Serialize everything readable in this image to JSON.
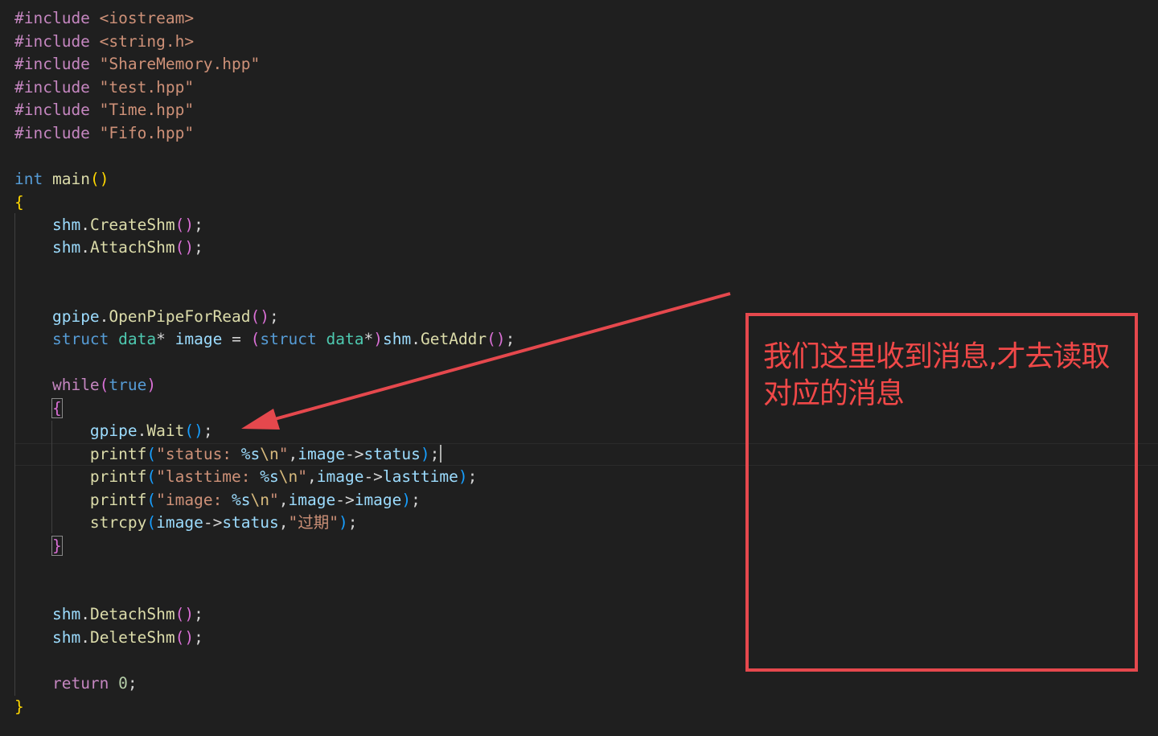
{
  "editor": {
    "lines": {
      "l1": {
        "kw": "#include",
        "arg": "<iostream>"
      },
      "l2": {
        "kw": "#include",
        "arg": "<string.h>"
      },
      "l3": {
        "kw": "#include",
        "arg": "\"ShareMemory.hpp\""
      },
      "l4": {
        "kw": "#include",
        "arg": "\"test.hpp\""
      },
      "l5": {
        "kw": "#include",
        "arg": "\"Time.hpp\""
      },
      "l6": {
        "kw": "#include",
        "arg": "\"Fifo.hpp\""
      },
      "l8": {
        "type": "int",
        "fn": "main",
        "parens": "()"
      },
      "l9": {
        "brace": "{"
      },
      "l10": {
        "obj": "shm",
        "fn": "CreateShm"
      },
      "l11": {
        "obj": "shm",
        "fn": "AttachShm"
      },
      "l14": {
        "obj": "gpipe",
        "fn": "OpenPipeForRead"
      },
      "l15": {
        "struct": "struct",
        "type": "data",
        "star": "*",
        "var": "image",
        "eq": " = ",
        "cast_struct": "struct",
        "cast_type": "data",
        "cast_star": "*",
        "obj": "shm",
        "fn": "GetAddr"
      },
      "l17": {
        "kw": "while",
        "cond": "true"
      },
      "l18": {
        "brace": "{"
      },
      "l19": {
        "obj": "gpipe",
        "fn": "Wait"
      },
      "l20": {
        "fn": "printf",
        "str_a": "\"status: ",
        "fmt": "%s",
        "esc": "\\n",
        "str_b": "\"",
        "obj": "image",
        "arrow": "->",
        "field": "status"
      },
      "l21": {
        "fn": "printf",
        "str_a": "\"lasttime: ",
        "fmt": "%s",
        "esc": "\\n",
        "str_b": "\"",
        "obj": "image",
        "arrow": "->",
        "field": "lasttime"
      },
      "l22": {
        "fn": "printf",
        "str_a": "\"image: ",
        "fmt": "%s",
        "esc": "\\n",
        "str_b": "\"",
        "obj": "image",
        "arrow": "->",
        "field": "image"
      },
      "l23": {
        "fn": "strcpy",
        "obj": "image",
        "arrow": "->",
        "field": "status",
        "str": "\"过期\""
      },
      "l24": {
        "brace": "}"
      },
      "l27": {
        "obj": "shm",
        "fn": "DetachShm"
      },
      "l28": {
        "obj": "shm",
        "fn": "DeleteShm"
      },
      "l30": {
        "kw": "return",
        "num": "0"
      },
      "l31": {
        "brace": "}"
      }
    }
  },
  "annotation": {
    "text": "我们这里收到消息,才去读取对应的消息",
    "color": "#e5484d"
  },
  "theme": {
    "background": "#1f1f1f"
  }
}
